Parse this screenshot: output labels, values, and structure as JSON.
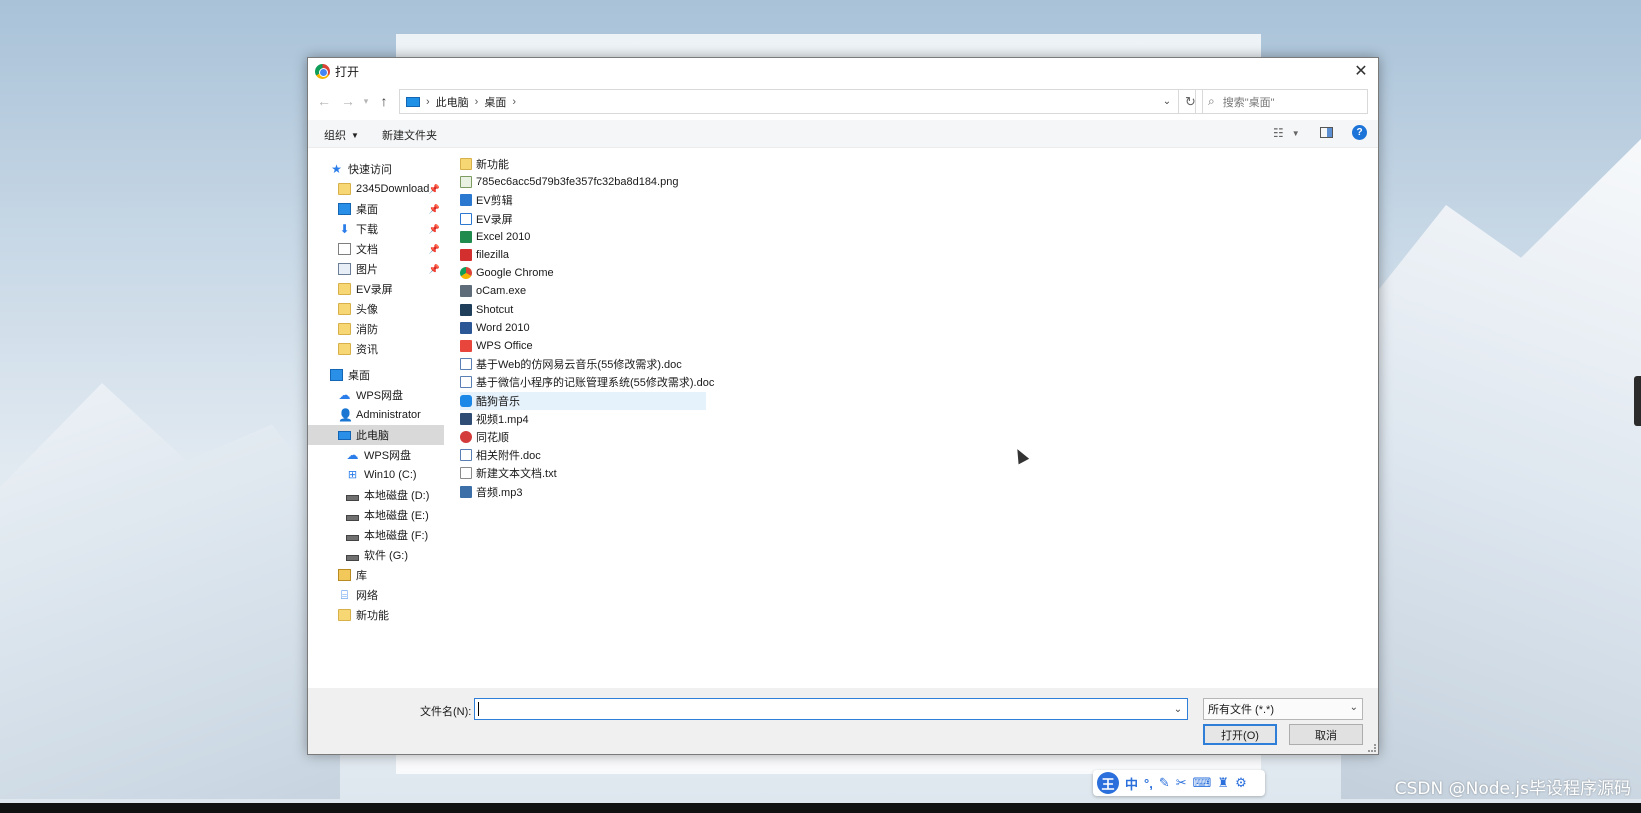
{
  "dialog": {
    "title": "打开",
    "address": {
      "crumbs": [
        "此电脑",
        "桌面"
      ]
    },
    "search_placeholder": "搜索\"桌面\"",
    "toolbar": {
      "organize": "组织",
      "new_folder": "新建文件夹",
      "help": "?"
    },
    "sidebar": [
      {
        "label": "快速访问",
        "icon": "star-icon"
      },
      {
        "label": "2345Download",
        "icon": "folder-icon",
        "pinned": true
      },
      {
        "label": "桌面",
        "icon": "desktop-icon",
        "pinned": true
      },
      {
        "label": "下载",
        "icon": "download-icon",
        "pinned": true
      },
      {
        "label": "文档",
        "icon": "document-icon",
        "pinned": true
      },
      {
        "label": "图片",
        "icon": "picture-icon",
        "pinned": true
      },
      {
        "label": "EV录屏",
        "icon": "folder-icon"
      },
      {
        "label": "头像",
        "icon": "folder-icon"
      },
      {
        "label": "消防",
        "icon": "folder-icon"
      },
      {
        "label": "资讯",
        "icon": "folder-icon"
      },
      {
        "label": "桌面",
        "icon": "desktop-icon"
      },
      {
        "label": "WPS网盘",
        "icon": "cloud-icon"
      },
      {
        "label": "Administrator",
        "icon": "user-icon"
      },
      {
        "label": "此电脑",
        "icon": "computer-icon",
        "selected": true
      },
      {
        "label": "WPS网盘",
        "icon": "cloud-icon"
      },
      {
        "label": "Win10 (C:)",
        "icon": "windows-drive-icon"
      },
      {
        "label": "本地磁盘 (D:)",
        "icon": "drive-icon"
      },
      {
        "label": "本地磁盘 (E:)",
        "icon": "drive-icon"
      },
      {
        "label": "本地磁盘 (F:)",
        "icon": "drive-icon"
      },
      {
        "label": "软件 (G:)",
        "icon": "drive-icon"
      },
      {
        "label": "库",
        "icon": "library-icon"
      },
      {
        "label": "网络",
        "icon": "network-icon"
      },
      {
        "label": "新功能",
        "icon": "folder-icon"
      }
    ],
    "files": [
      {
        "name": "新功能",
        "icon": "folder-icon"
      },
      {
        "name": "785ec6acc5d79b3fe357fc32ba8d184.png",
        "icon": "image-file-icon"
      },
      {
        "name": "EV剪辑",
        "icon": "ev-edit-icon"
      },
      {
        "name": "EV录屏",
        "icon": "ev-record-icon"
      },
      {
        "name": "Excel 2010",
        "icon": "excel-icon"
      },
      {
        "name": "filezilla",
        "icon": "filezilla-icon"
      },
      {
        "name": "Google Chrome",
        "icon": "chrome-icon"
      },
      {
        "name": "oCam.exe",
        "icon": "ocam-icon"
      },
      {
        "name": "Shotcut",
        "icon": "shotcut-icon"
      },
      {
        "name": "Word 2010",
        "icon": "word-icon"
      },
      {
        "name": "WPS Office",
        "icon": "wps-icon"
      },
      {
        "name": "基于Web的仿网易云音乐(55修改需求).doc",
        "icon": "doc-file-icon"
      },
      {
        "name": "基于微信小程序的记账管理系统(55修改需求).doc",
        "icon": "doc-file-icon"
      },
      {
        "name": "酷狗音乐",
        "icon": "kugou-icon",
        "hover": true
      },
      {
        "name": "视频1.mp4",
        "icon": "video-file-icon"
      },
      {
        "name": "同花顺",
        "icon": "tonghuashun-icon"
      },
      {
        "name": "相关附件.doc",
        "icon": "doc-file-icon"
      },
      {
        "name": "新建文本文档.txt",
        "icon": "text-file-icon"
      },
      {
        "name": "音频.mp3",
        "icon": "audio-file-icon"
      }
    ],
    "filename_label": "文件名(N):",
    "filename_value": "",
    "filetype": "所有文件 (*.*)",
    "open_button": "打开(O)",
    "cancel_button": "取消"
  },
  "ime": {
    "logo": "王",
    "mode": "中"
  },
  "watermark": "CSDN @Node.js毕设程序源码"
}
